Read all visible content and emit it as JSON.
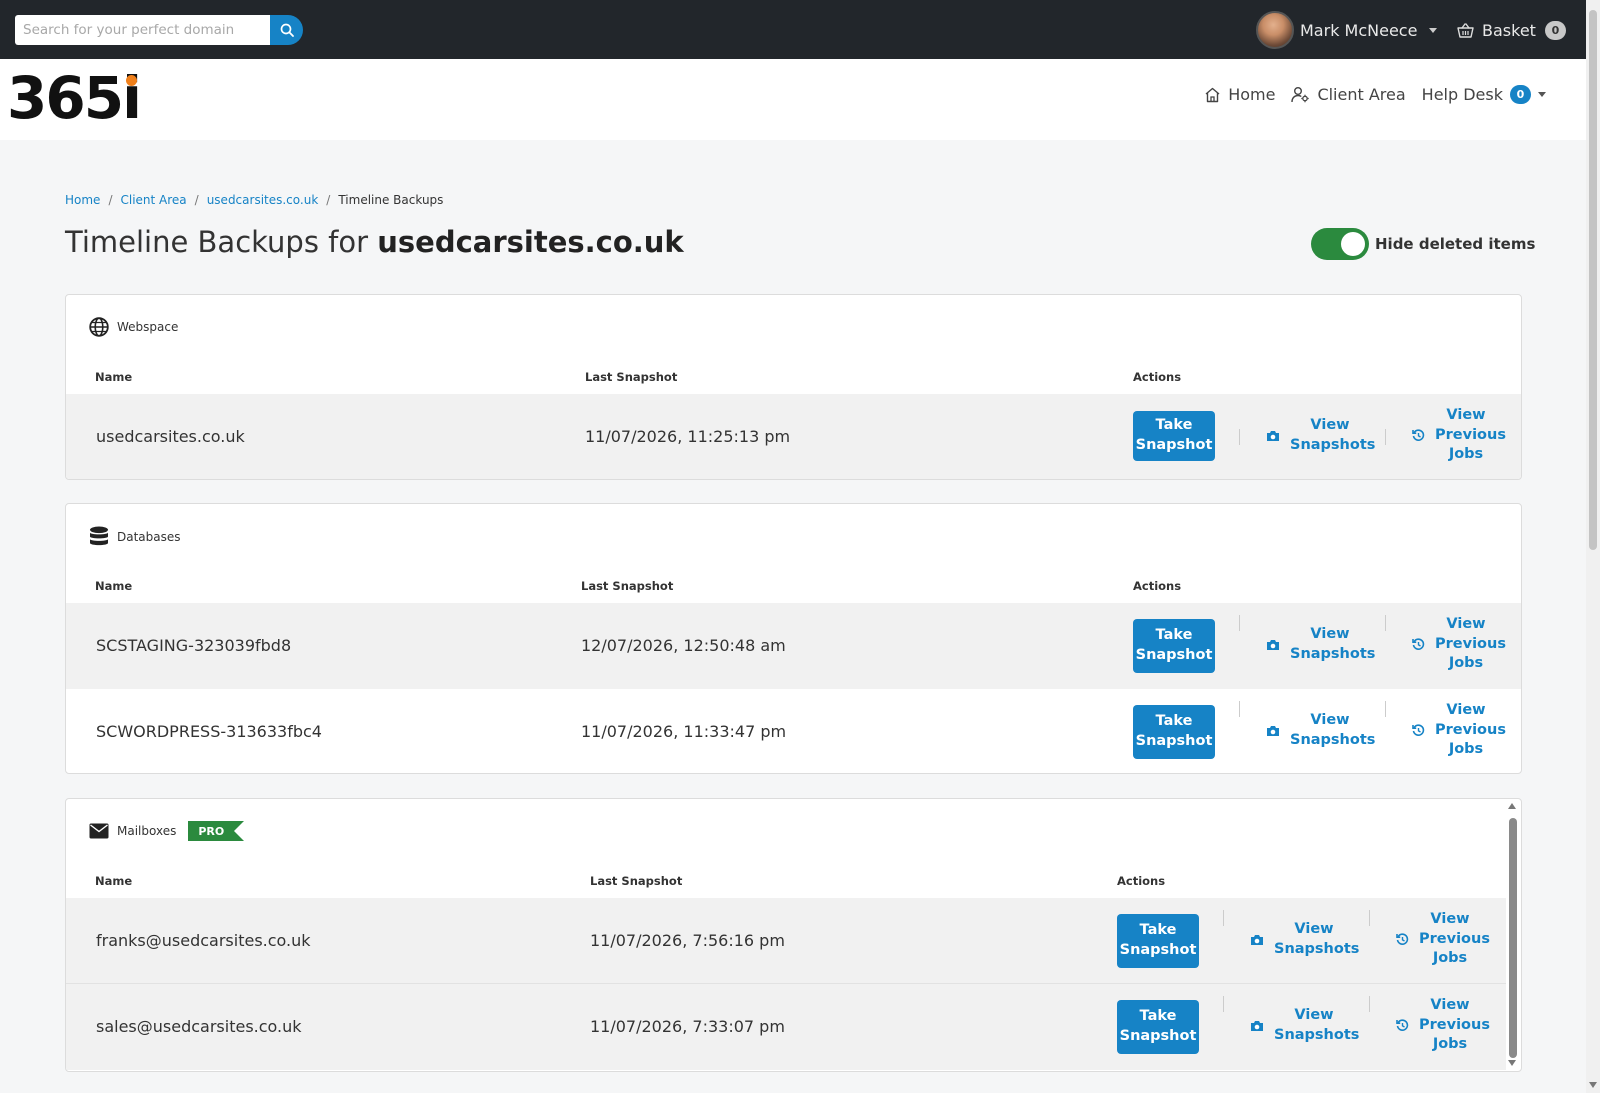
{
  "topbar": {
    "search_placeholder": "Search for your perfect domain",
    "user_name": "Mark McNeece",
    "basket_label": "Basket",
    "basket_count": "0"
  },
  "header": {
    "logo_text": "365i",
    "nav": {
      "home": "Home",
      "client_area": "Client Area",
      "help_desk": "Help Desk",
      "help_desk_count": "0"
    }
  },
  "breadcrumb": {
    "items": [
      "Home",
      "Client Area",
      "usedcarsites.co.uk"
    ],
    "current": "Timeline Backups",
    "separator": "/"
  },
  "page": {
    "title_prefix": "Timeline Backups for",
    "title_domain": "usedcarsites.co.uk",
    "toggle_label": "Hide deleted items"
  },
  "columns": {
    "name": "Name",
    "last_snapshot": "Last Snapshot",
    "actions": "Actions"
  },
  "actions": {
    "take_snapshot": "Take Snapshot",
    "view_snapshots": "View Snapshots",
    "view_previous_jobs": "View Previous Jobs"
  },
  "webspace": {
    "title": "Webspace",
    "rows": [
      {
        "name": "usedcarsites.co.uk",
        "last_snapshot": "11/07/2026, 11:25:13 pm"
      }
    ]
  },
  "databases": {
    "title": "Databases",
    "rows": [
      {
        "name": "SCSTAGING-323039fbd8",
        "last_snapshot": "12/07/2026, 12:50:48 am"
      },
      {
        "name": "SCWORDPRESS-313633fbc4",
        "last_snapshot": "11/07/2026, 11:33:47 pm"
      }
    ]
  },
  "mailboxes": {
    "title": "Mailboxes",
    "badge": "PRO",
    "rows": [
      {
        "name": "franks@usedcarsites.co.uk",
        "last_snapshot": "11/07/2026, 7:56:16 pm"
      },
      {
        "name": "sales@usedcarsites.co.uk",
        "last_snapshot": "11/07/2026, 7:33:07 pm"
      }
    ]
  },
  "colors": {
    "accent": "#1683c6",
    "topbar": "#22262b",
    "toggle_on": "#2b8a3e",
    "logo_dot": "#f0801b"
  }
}
